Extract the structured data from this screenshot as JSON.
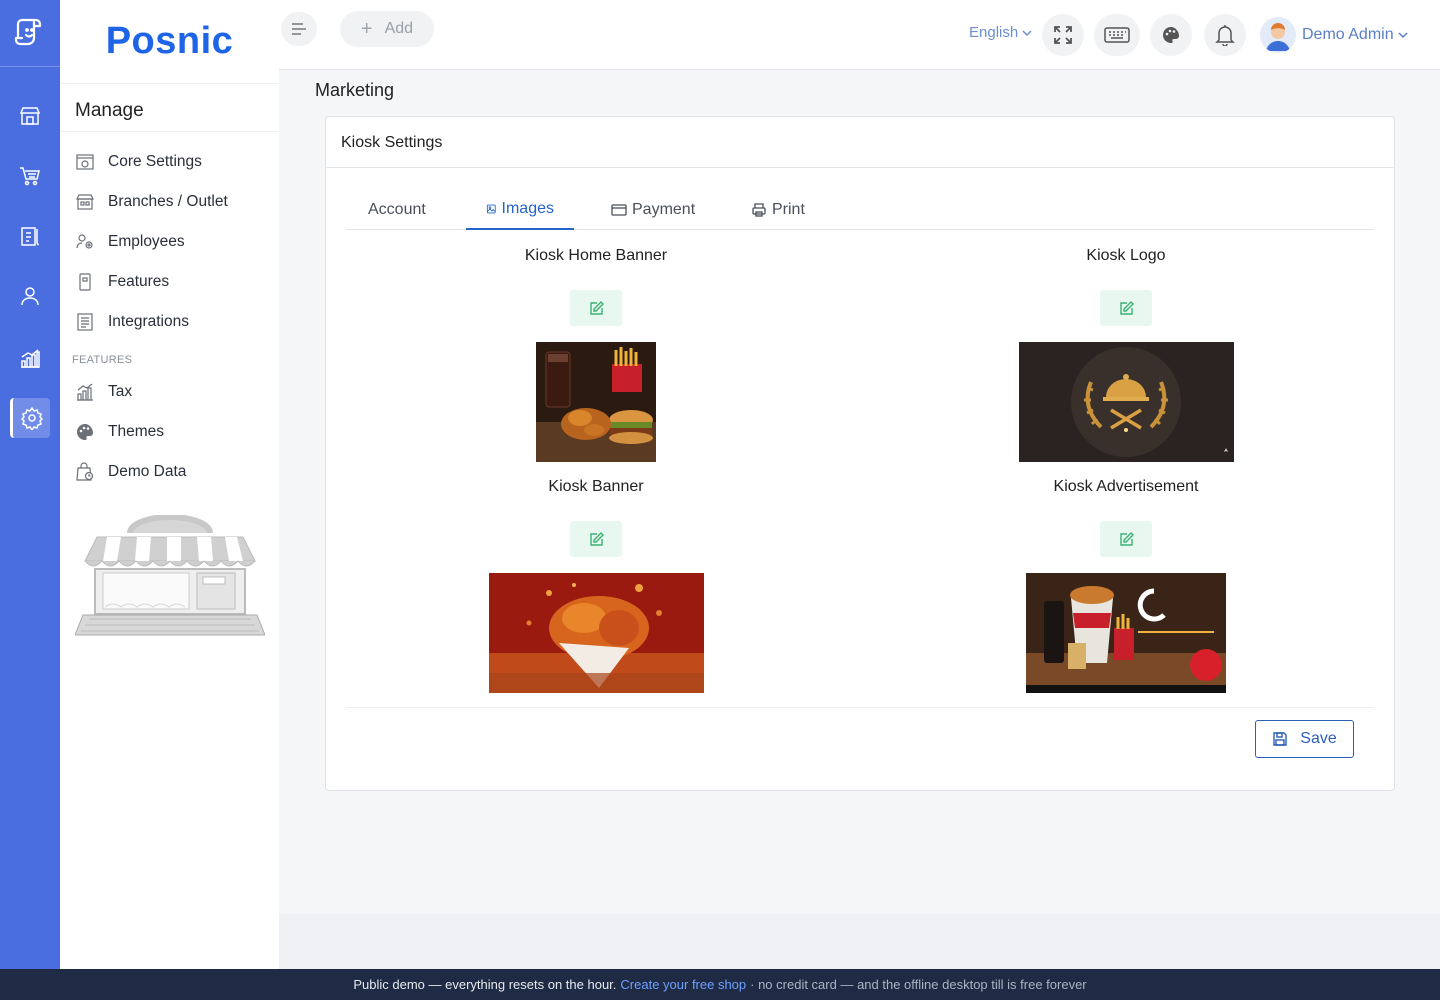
{
  "brand": "Posnic",
  "sidebar": {
    "title": "Manage",
    "items": [
      {
        "label": "Core Settings",
        "icon": "core-settings-icon"
      },
      {
        "label": "Branches / Outlet",
        "icon": "branches-icon"
      },
      {
        "label": "Employees",
        "icon": "employees-icon"
      },
      {
        "label": "Features",
        "icon": "features-icon"
      },
      {
        "label": "Integrations",
        "icon": "integrations-icon"
      }
    ],
    "section_label": "FEATURES",
    "feature_items": [
      {
        "label": "Tax",
        "icon": "tax-icon"
      },
      {
        "label": "Themes",
        "icon": "themes-icon"
      },
      {
        "label": "Demo Data",
        "icon": "demo-data-icon"
      }
    ]
  },
  "rail": [
    "store-icon",
    "cart-icon",
    "clipboard-icon",
    "user-icon",
    "chart-icon",
    "gear-icon"
  ],
  "topbar": {
    "add_label": "Add",
    "language": "English",
    "user_name": "Demo Admin"
  },
  "page": {
    "title": "Marketing",
    "card_title": "Kiosk Settings",
    "tabs": [
      "Account",
      "Images",
      "Payment",
      "Print"
    ],
    "active_tab": "Images",
    "images": [
      {
        "label": "Kiosk Home Banner"
      },
      {
        "label": "Kiosk Logo"
      },
      {
        "label": "Kiosk Banner"
      },
      {
        "label": "Kiosk Advertisement"
      }
    ],
    "save_label": "Save"
  },
  "footer": {
    "text1": "Public demo — everything resets on the hour.",
    "link": "Create your free shop",
    "text2": "· no credit card — and the offline desktop till is free forever"
  },
  "colors": {
    "rail": "#4a6ee0",
    "brand": "#1e64e6",
    "accent": "#2563c9",
    "footer": "#1f2a44"
  }
}
